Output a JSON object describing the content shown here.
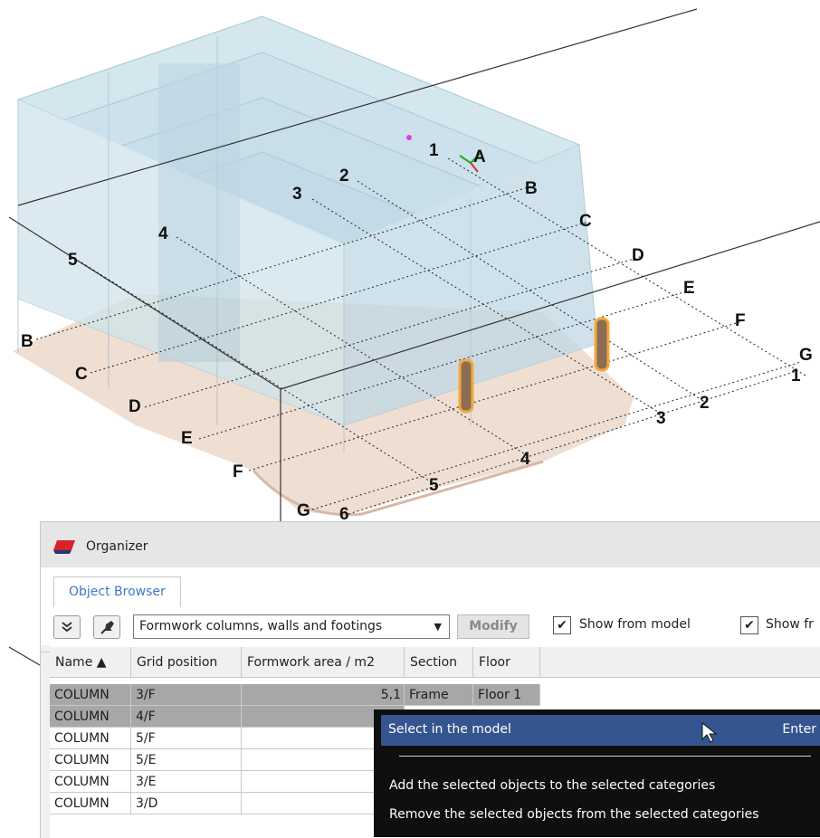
{
  "viewport": {
    "grid_left_labels": [
      "5",
      "4",
      "3",
      "2",
      "1",
      "A",
      "B",
      "C",
      "D",
      "E",
      "F",
      "G"
    ],
    "grid_left_side": [
      "B",
      "C",
      "D",
      "E",
      "F",
      "G",
      "6"
    ],
    "grid_right_side": [
      "1",
      "2",
      "3",
      "4",
      "5"
    ],
    "colors": {
      "building": "#9fc6d8",
      "footing": "#e8d4c6",
      "highlight": "#f2a93b"
    }
  },
  "organizer": {
    "title": "Organizer",
    "tabs": [
      {
        "label": "Object Browser"
      }
    ],
    "toolbar": {
      "expand_icon": "double-chevron-down-icon",
      "pin_icon": "pin-icon",
      "category": "Formwork columns, walls and footings",
      "modify_label": "Modify",
      "show_from_model_label": "Show from model",
      "show_second_label": "Show fr"
    },
    "table": {
      "columns": [
        "Name ▲",
        "Grid position",
        "Formwork area / m2",
        "Section",
        "Floor"
      ],
      "rows": [
        {
          "name": "COLUMN",
          "grid": "3/F",
          "area": "5,1",
          "section": "Frame",
          "floor": "Floor 1",
          "selected": true
        },
        {
          "name": "COLUMN",
          "grid": "4/F",
          "area": "",
          "section": "",
          "floor": "",
          "selected": true
        },
        {
          "name": "COLUMN",
          "grid": "5/F",
          "area": "",
          "section": "",
          "floor": "",
          "selected": false
        },
        {
          "name": "COLUMN",
          "grid": "5/E",
          "area": "",
          "section": "",
          "floor": "",
          "selected": false
        },
        {
          "name": "COLUMN",
          "grid": "3/E",
          "area": "",
          "section": "",
          "floor": "",
          "selected": false
        },
        {
          "name": "COLUMN",
          "grid": "3/D",
          "area": "",
          "section": "",
          "floor": "",
          "selected": false
        }
      ]
    }
  },
  "context_menu": {
    "select_in_model": "Select in the model",
    "select_shortcut": "Enter",
    "add_to_categories": "Add the selected objects to the selected categories",
    "remove_from_categories": "Remove the selected objects from the selected categories"
  }
}
